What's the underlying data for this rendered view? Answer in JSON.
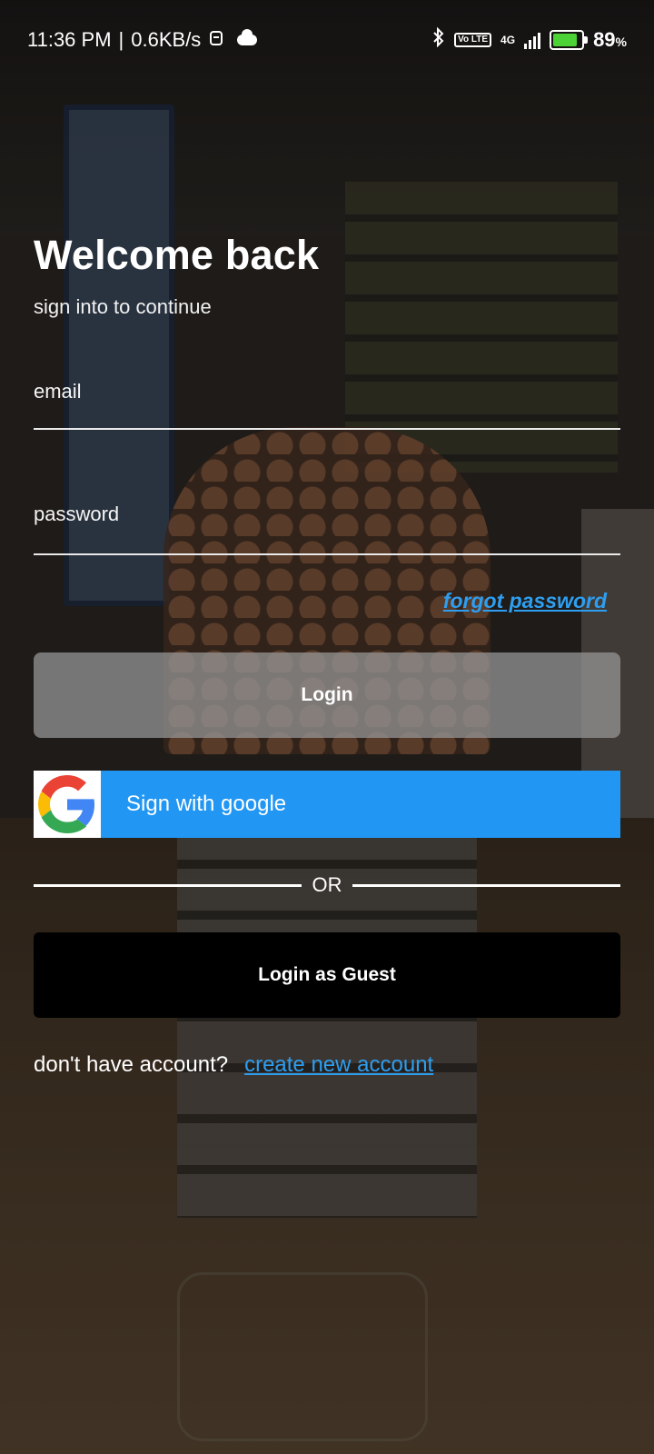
{
  "status_bar": {
    "time": "11:36 PM",
    "speed": "0.6KB/s",
    "network": "4G",
    "volte": "Vo LTE",
    "battery": "89",
    "battery_unit": "%"
  },
  "login": {
    "title": "Welcome back",
    "subtitle": "sign into to continue",
    "email_label": "email",
    "password_label": "password",
    "forgot_label": "forgot password",
    "login_button": "Login",
    "google_button": "Sign with google",
    "or_text": "OR",
    "guest_button": "Login as Guest",
    "no_account_text": "don't have account?",
    "create_account_link": "create new account"
  },
  "colors": {
    "google_blue": "#2196F3",
    "link_blue": "#2E9EF0",
    "guest_black": "#000000"
  },
  "icons": [
    "bluetooth-icon",
    "volte-icon",
    "signal-icon",
    "battery-icon",
    "cloud-icon",
    "google-logo-icon"
  ]
}
